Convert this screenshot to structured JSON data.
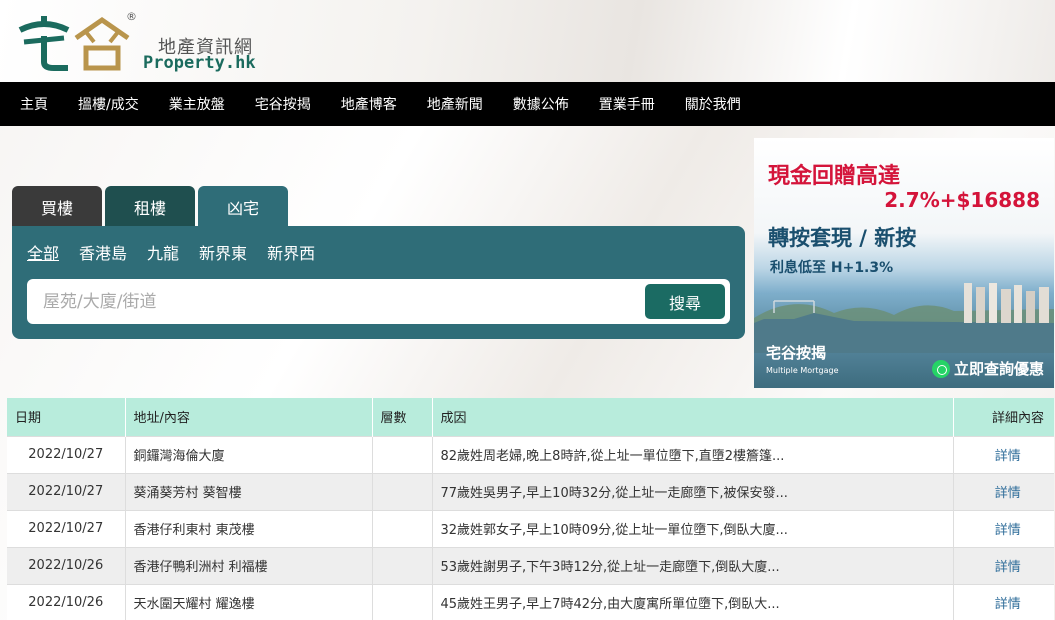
{
  "header": {
    "logo_cn": "宅谷",
    "logo_reg": "®",
    "site_name_cn": "地產資訊網",
    "site_name_en": "Property.hk"
  },
  "nav": {
    "items": [
      "主頁",
      "搵樓/成交",
      "業主放盤",
      "宅谷按揭",
      "地產博客",
      "地產新聞",
      "數據公佈",
      "置業手冊",
      "關於我們"
    ]
  },
  "search": {
    "tabs": [
      "買樓",
      "租樓",
      "凶宅"
    ],
    "active_tab": "凶宅",
    "regions": [
      "全部",
      "香港島",
      "九龍",
      "新界東",
      "新界西"
    ],
    "active_region": "全部",
    "placeholder": "屋苑/大廈/街道",
    "button": "搜尋"
  },
  "ad": {
    "line1": "現金回贈高達",
    "line2": "2.7%+$16888",
    "line3": "轉按套現 / 新按",
    "line4": "利息低至 H+1.3%",
    "brand": "宅谷按揭",
    "brand_sub": "Multiple Mortgage",
    "cta": "立即查詢優惠"
  },
  "table": {
    "headers": [
      "日期",
      "地址/內容",
      "層數",
      "成因",
      "詳細內容"
    ],
    "rows": [
      {
        "date": "2022/10/27",
        "address": "銅鑼灣海倫大廈",
        "floor": "",
        "cause": "82歲姓周老婦,晚上8時許,從上址一單位墮下,直墮2樓簷篷...",
        "detail": "詳情"
      },
      {
        "date": "2022/10/27",
        "address": "葵涌葵芳村 葵智樓",
        "floor": "",
        "cause": "77歲姓吳男子,早上10時32分,從上址一走廊墮下,被保安發...",
        "detail": "詳情"
      },
      {
        "date": "2022/10/27",
        "address": "香港仔利東村 東茂樓",
        "floor": "",
        "cause": "32歲姓郭女子,早上10時09分,從上址一單位墮下,倒臥大廈...",
        "detail": "詳情"
      },
      {
        "date": "2022/10/26",
        "address": "香港仔鴨利洲村 利福樓",
        "floor": "",
        "cause": "53歲姓謝男子,下午3時12分,從上址一走廊墮下,倒臥大廈...",
        "detail": "詳情"
      },
      {
        "date": "2022/10/26",
        "address": "天水圍天耀村 耀逸樓",
        "floor": "",
        "cause": "45歲姓王男子,早上7時42分,由大廈寓所單位墮下,倒臥大...",
        "detail": "詳情"
      }
    ]
  }
}
